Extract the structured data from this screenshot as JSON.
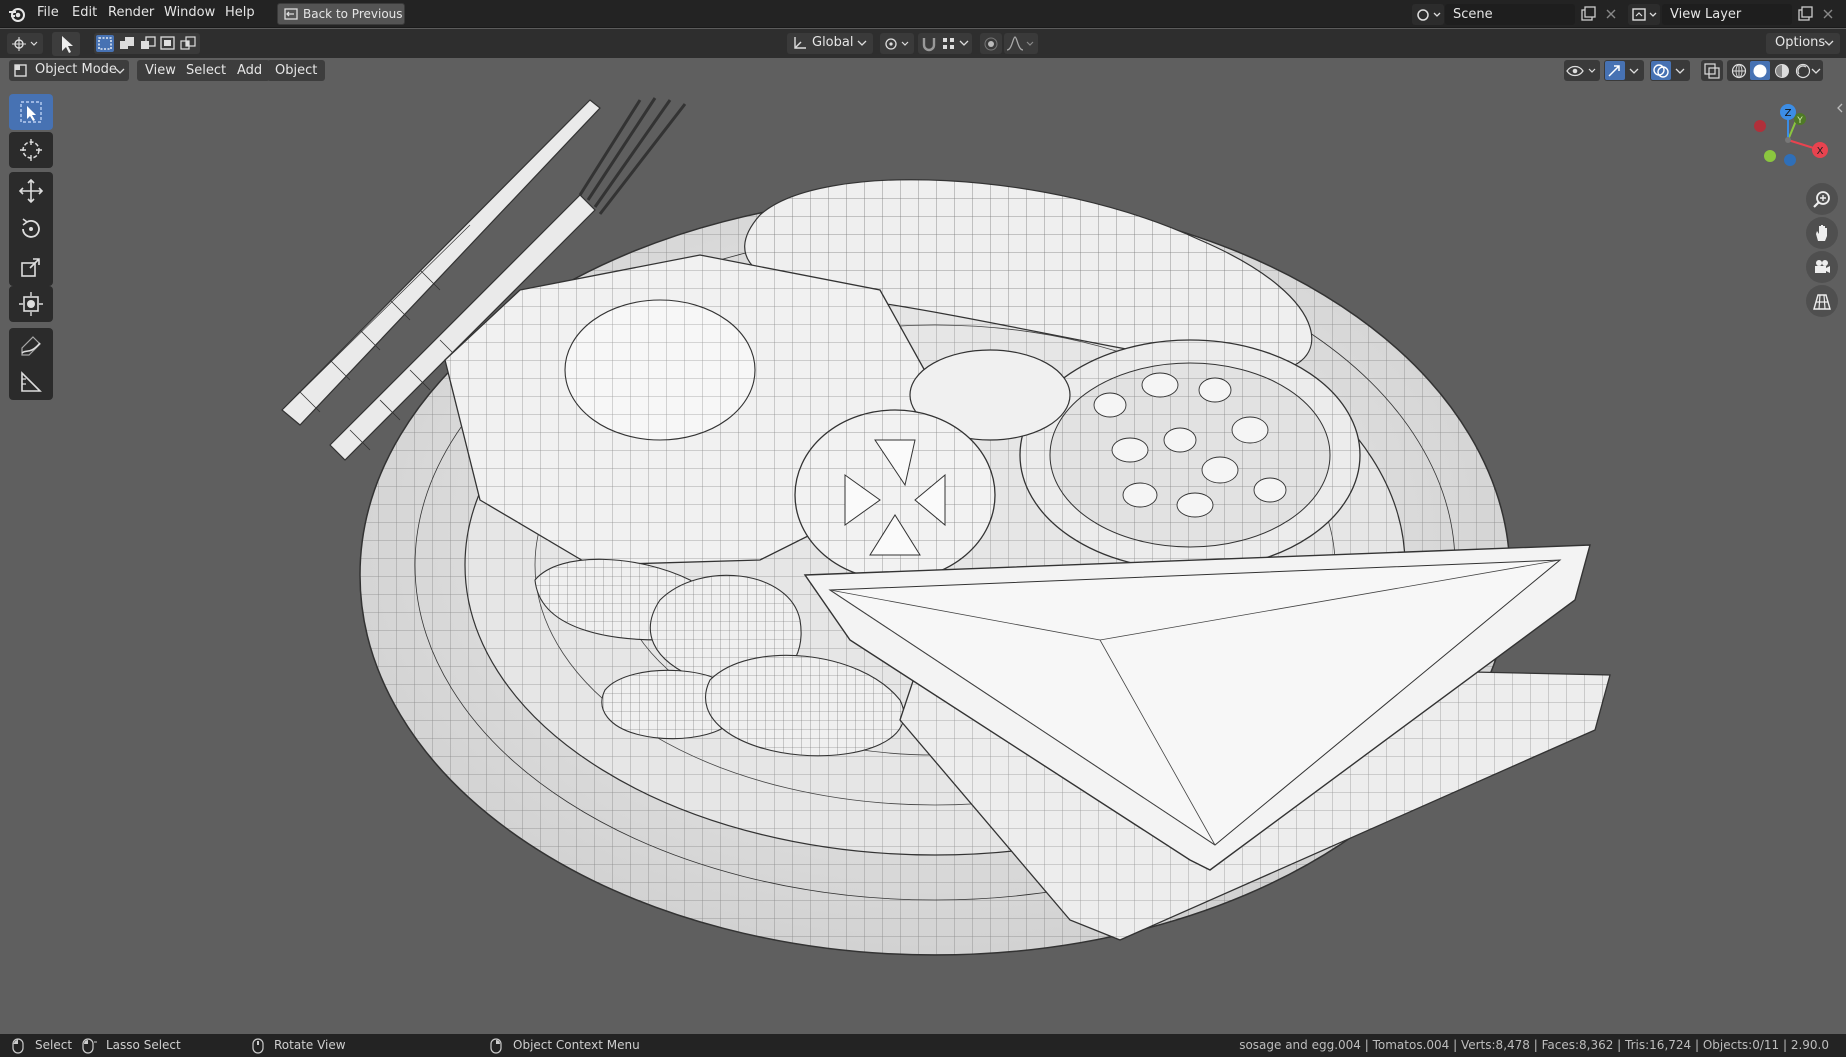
{
  "menu": {
    "items": [
      "File",
      "Edit",
      "Render",
      "Window",
      "Help"
    ],
    "back_button": "Back to Previous"
  },
  "topbar_right": {
    "scene_label": "Scene",
    "view_layer_label": "View Layer"
  },
  "tool_header": {
    "transform_orientation": "Global",
    "options_label": "Options"
  },
  "viewport_header": {
    "mode": "Object Mode",
    "menus": [
      "View",
      "Select",
      "Add",
      "Object"
    ]
  },
  "toolbar": {
    "tools": [
      "select-box",
      "cursor",
      "move",
      "rotate",
      "scale",
      "transform",
      "annotate",
      "measure"
    ],
    "active": "select-box",
    "accent": "#4772b3"
  },
  "navigation": {
    "gizmo_axes": {
      "x": "X",
      "y": "Y",
      "z": "Z"
    },
    "axis_colors": {
      "x": "#e8434f",
      "y": "#8bc63f",
      "z": "#3c8de5"
    },
    "buttons": [
      "zoom-icon",
      "pan-hand-icon",
      "camera-icon",
      "ortho-grid-icon"
    ]
  },
  "status": {
    "select": "Select",
    "lasso_select": "Lasso Select",
    "rotate_view": "Rotate View",
    "context_menu": "Object Context Menu",
    "stats": "sosage and egg.004 | Tomatos.004 | Verts:8,478 | Faces:8,362 | Tris:16,724 | Objects:0/11 | 2.90.0"
  }
}
